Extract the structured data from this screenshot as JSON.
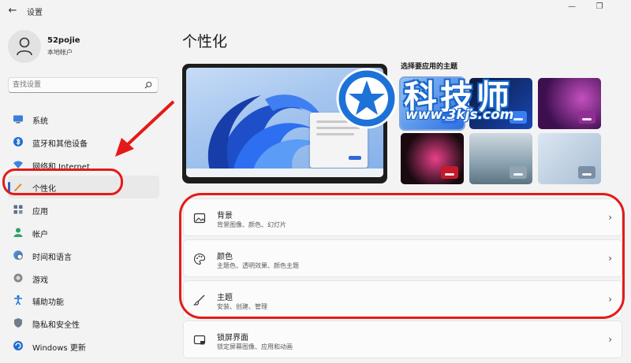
{
  "window": {
    "title": "设置",
    "back_icon": "back-arrow-icon",
    "minimize_icon": "minimize-icon",
    "maximize_icon": "restore-icon"
  },
  "user": {
    "name": "52pojie",
    "account_type": "本地帐户"
  },
  "search": {
    "placeholder": "查找设置"
  },
  "nav": {
    "items": [
      {
        "label": "系统",
        "icon": "system-monitor-icon"
      },
      {
        "label": "蓝牙和其他设备",
        "icon": "bluetooth-icon"
      },
      {
        "label": "网络和 Internet",
        "icon": "wifi-icon"
      },
      {
        "label": "个性化",
        "icon": "pen-brush-icon",
        "active": true
      },
      {
        "label": "应用",
        "icon": "apps-icon"
      },
      {
        "label": "帐户",
        "icon": "account-icon"
      },
      {
        "label": "时间和语言",
        "icon": "globe-clock-icon"
      },
      {
        "label": "游戏",
        "icon": "gamepad-icon"
      },
      {
        "label": "辅助功能",
        "icon": "accessibility-icon"
      },
      {
        "label": "隐私和安全性",
        "icon": "shield-icon"
      },
      {
        "label": "Windows 更新",
        "icon": "update-icon"
      }
    ]
  },
  "main": {
    "title": "个性化",
    "themes_label": "选择要应用的主题",
    "cards": [
      {
        "title": "背景",
        "subtitle": "背景图像、颜色、幻灯片",
        "icon": "image-icon"
      },
      {
        "title": "颜色",
        "subtitle": "主题色、透明效果、颜色主题",
        "icon": "palette-icon"
      },
      {
        "title": "主题",
        "subtitle": "安装、创建、管理",
        "icon": "brush-icon"
      },
      {
        "title": "锁屏界面",
        "subtitle": "锁定屏幕图像、应用和动画",
        "icon": "lock-screen-icon"
      }
    ]
  },
  "watermark": {
    "title": "科技师",
    "url": "www.3kjs.com"
  },
  "colors": {
    "accent": "#2e63c8",
    "annotation_red": "#e41a1a"
  }
}
